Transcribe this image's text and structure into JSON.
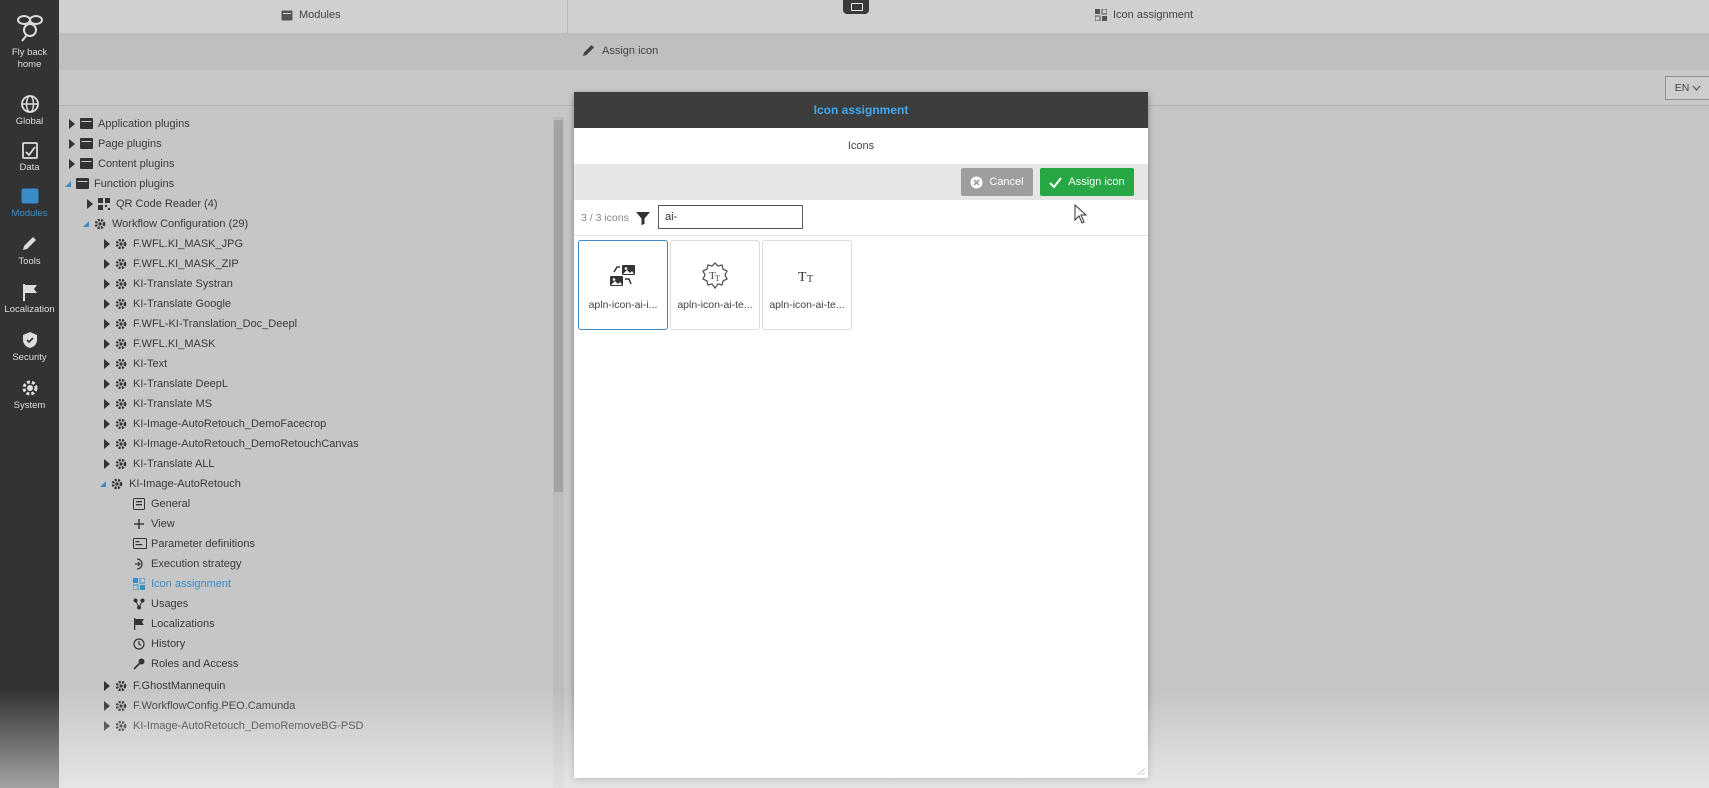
{
  "rail": {
    "home_label": "Fly back home",
    "items": [
      {
        "label": "Global",
        "icon": "globe-icon"
      },
      {
        "label": "Data",
        "icon": "data-icon"
      },
      {
        "label": "Modules",
        "icon": "modules-icon",
        "active": true
      },
      {
        "label": "Tools",
        "icon": "pencil-icon"
      },
      {
        "label": "Localization",
        "icon": "flag-icon"
      },
      {
        "label": "Security",
        "icon": "shield-icon"
      },
      {
        "label": "System",
        "icon": "gear-icon"
      }
    ]
  },
  "tabs": {
    "modules": "Modules",
    "icon_assignment": "Icon assignment"
  },
  "toolbar": {
    "assign_icon": "Assign icon",
    "language": "EN"
  },
  "tree": {
    "nodes": [
      {
        "label": "Application plugins"
      },
      {
        "label": "Page plugins"
      },
      {
        "label": "Content plugins"
      },
      {
        "label": "Function plugins"
      },
      {
        "label": "QR Code Reader (4)"
      },
      {
        "label": "Workflow Configuration (29)"
      },
      {
        "label": "F.WFL.KI_MASK_JPG"
      },
      {
        "label": "F.WFL.KI_MASK_ZIP"
      },
      {
        "label": "KI-Translate Systran"
      },
      {
        "label": "KI-Translate Google"
      },
      {
        "label": "F.WFL-KI-Translation_Doc_Deepl"
      },
      {
        "label": "F.WFL.KI_MASK"
      },
      {
        "label": "KI-Text"
      },
      {
        "label": "KI-Translate DeepL"
      },
      {
        "label": "KI-Translate MS"
      },
      {
        "label": "KI-Image-AutoRetouch_DemoFacecrop"
      },
      {
        "label": "KI-Image-AutoRetouch_DemoRetouchCanvas"
      },
      {
        "label": "KI-Translate ALL"
      },
      {
        "label": "KI-Image-AutoRetouch"
      },
      {
        "label": "General"
      },
      {
        "label": "View"
      },
      {
        "label": "Parameter definitions"
      },
      {
        "label": "Execution strategy"
      },
      {
        "label": "Icon assignment"
      },
      {
        "label": "Usages"
      },
      {
        "label": "Localizations"
      },
      {
        "label": "History"
      },
      {
        "label": "Roles and Access"
      },
      {
        "label": "F.GhostMannequin"
      },
      {
        "label": "F.WorkflowConfig.PEO.Camunda"
      },
      {
        "label": "KI-Image-AutoRetouch_DemoRemoveBG-PSD"
      }
    ]
  },
  "modal": {
    "title": "Icon assignment",
    "subtitle": "Icons",
    "cancel_label": "Cancel",
    "assign_label": "Assign icon",
    "count": "3 / 3 icons",
    "search_value": "ai-",
    "tiles": [
      {
        "label": "apln-icon-ai-i...",
        "icon": "ai-image-swap-icon",
        "selected": true
      },
      {
        "label": "apln-icon-ai-te...",
        "icon": "ai-text-gear-icon"
      },
      {
        "label": "apln-icon-ai-te...",
        "icon": "ai-text-icon"
      }
    ]
  },
  "colors": {
    "accent": "#3a8dc7",
    "title_blue": "#3fa9f5",
    "success": "#27a844",
    "rail_bg": "#333333"
  }
}
